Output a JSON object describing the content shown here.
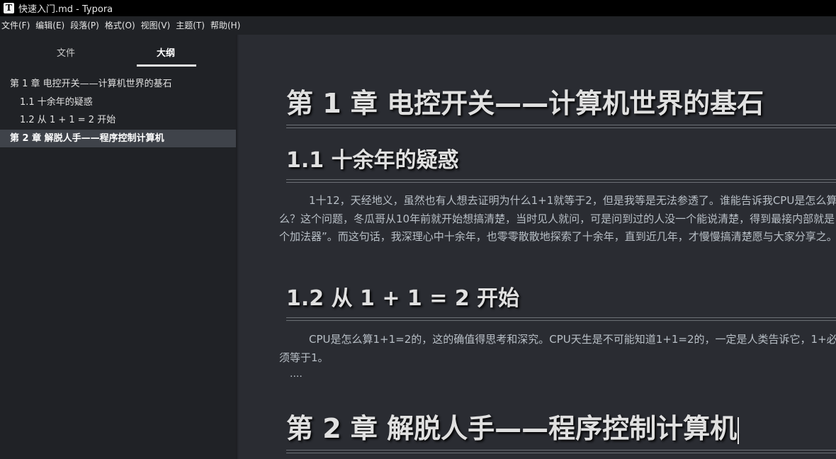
{
  "window": {
    "title": "快速入门.md - Typora",
    "app_icon_letter": "T"
  },
  "menubar": {
    "items": [
      "文件(F)",
      "编辑(E)",
      "段落(P)",
      "格式(O)",
      "视图(V)",
      "主题(T)",
      "帮助(H)"
    ]
  },
  "sidebar": {
    "tabs": {
      "files": "文件",
      "outline": "大纲",
      "active": "outline"
    },
    "outline": [
      {
        "label": "第 1 章 电控开关——计算机世界的基石",
        "level": 1,
        "active": false
      },
      {
        "label": "1.1 十余年的疑惑",
        "level": 2,
        "active": false
      },
      {
        "label": "1.2 从 1 + 1 = 2 开始",
        "level": 2,
        "active": false
      },
      {
        "label": "第 2 章 解脱人手——程序控制计算机",
        "level": 1,
        "active": true
      }
    ]
  },
  "document": {
    "h1_1": "第 1 章 电控开关——计算机世界的基石",
    "h2_1": "1.1 十余年的疑惑",
    "p1": "1十12，天经地义，虽然也有人想去证明为什么1+1就等于2，但是我等是无法参透了。谁能告诉我CPU是怎么算么？这个问题，冬瓜哥从10年前就开始想搞清楚，当时见人就问，可是问到过的人没一个能说清楚，得到最接内部就是个加法器”。而这句话，我深理心中十余年，也零零散散地探索了十余年，直到近几年，才慢慢搞清楚愿与大家分享之。",
    "h2_2": "1.2 从 1 + 1 = 2 开始",
    "p2": "CPU是怎么算1+1=2的，这的确值得思考和深究。CPU天生是不可能知道1+1=2的，一定是人类告诉它，1+必须等于1。",
    "ellipsis": "....",
    "h1_2": "第 2 章 解脱人手——程序控制计算机"
  },
  "colors": {
    "editor_bg": "#2a2c32",
    "sidebar_bg": "#202226",
    "titlebar_bg": "#000000",
    "active_outline_bg": "#3f434a"
  }
}
